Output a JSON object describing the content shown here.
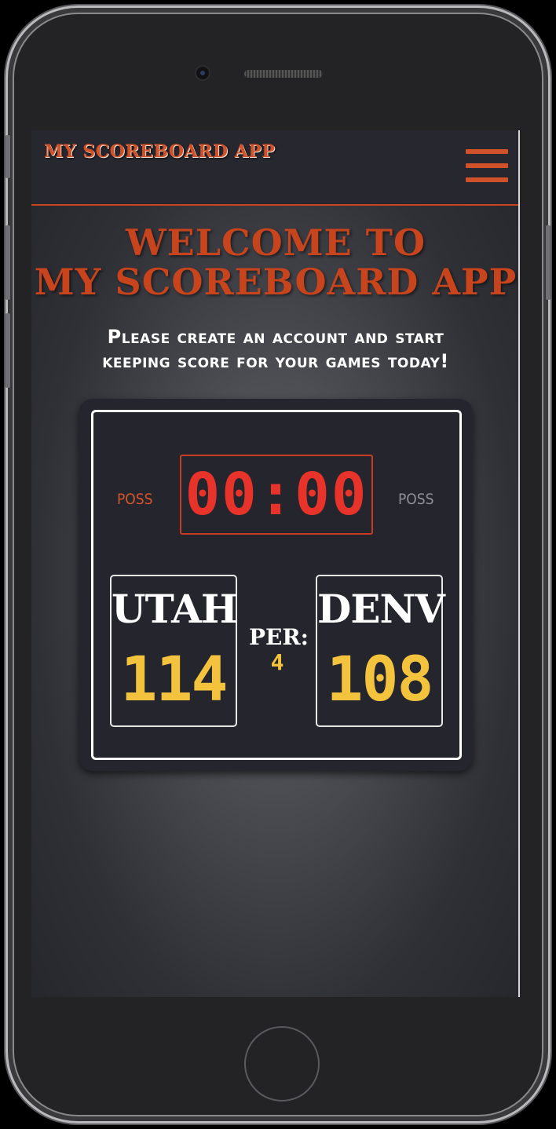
{
  "app": {
    "brand": "MY SCOREBOARD APP",
    "menu_icon": "hamburger-menu-icon"
  },
  "hero": {
    "welcome_line1": "WELCOME TO",
    "welcome_line2": "MY SCOREBOARD APP",
    "tagline_line1": "Please create an account and start",
    "tagline_line2": "keeping score for your games today!"
  },
  "scoreboard": {
    "poss_left": "POSS",
    "poss_right": "POSS",
    "clock": "00:00",
    "period_label": "PER:",
    "period_value": "4",
    "home_team": {
      "name": "UTAH",
      "score": "114"
    },
    "away_team": {
      "name": "DENV",
      "score": "108"
    }
  },
  "colors": {
    "accent": "#c8441c",
    "clock_red": "#e8332a",
    "score_yellow": "#f4c33d",
    "board_bg": "#25262d",
    "nav_bg": "#26272f"
  }
}
